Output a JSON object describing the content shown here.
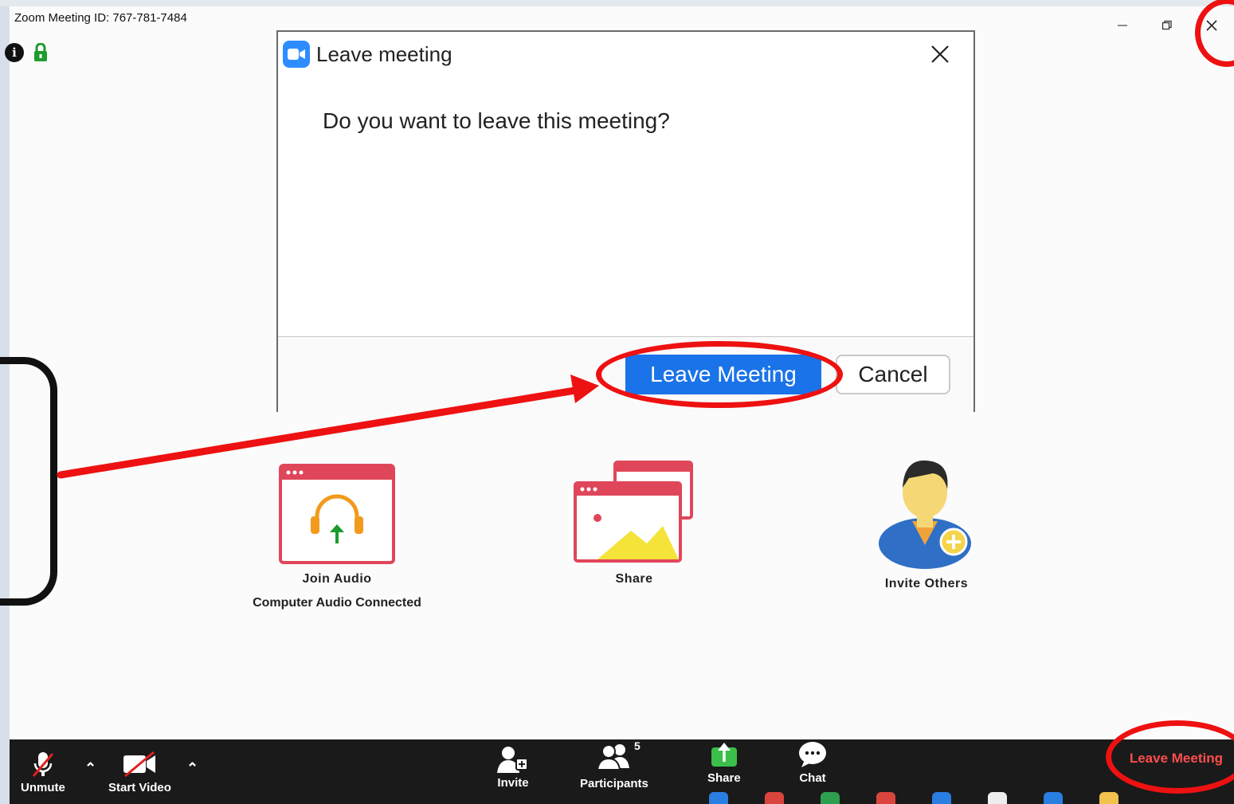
{
  "window": {
    "title": "Zoom Meeting ID: 767-781-7484",
    "controls": [
      "minimize-icon",
      "restore-icon",
      "close-icon"
    ]
  },
  "dialog": {
    "title": "Leave meeting",
    "message": "Do you want to leave this meeting?",
    "leave_label": "Leave Meeting",
    "cancel_label": "Cancel",
    "close_glyph": "✕"
  },
  "features": [
    {
      "label": "Join Audio",
      "sublabel": "Computer Audio Connected",
      "icon": "join-audio-icon"
    },
    {
      "label": "Share",
      "icon": "share-screen-icon"
    },
    {
      "label": "Invite Others",
      "icon": "invite-others-icon"
    }
  ],
  "toolbar": {
    "unmute_label": "Unmute",
    "start_video_label": "Start Video",
    "invite_label": "Invite",
    "participants_label": "Participants",
    "participants_count": "5",
    "share_label": "Share",
    "chat_label": "Chat",
    "leave_label": "Leave Meeting"
  },
  "colors": {
    "annotation_red": "#ee1111",
    "primary_blue": "#1a73e8",
    "zoom_blue": "#2d8cff",
    "toolbar_bg": "#1a1a1a",
    "leave_red": "#ff4d4d"
  }
}
